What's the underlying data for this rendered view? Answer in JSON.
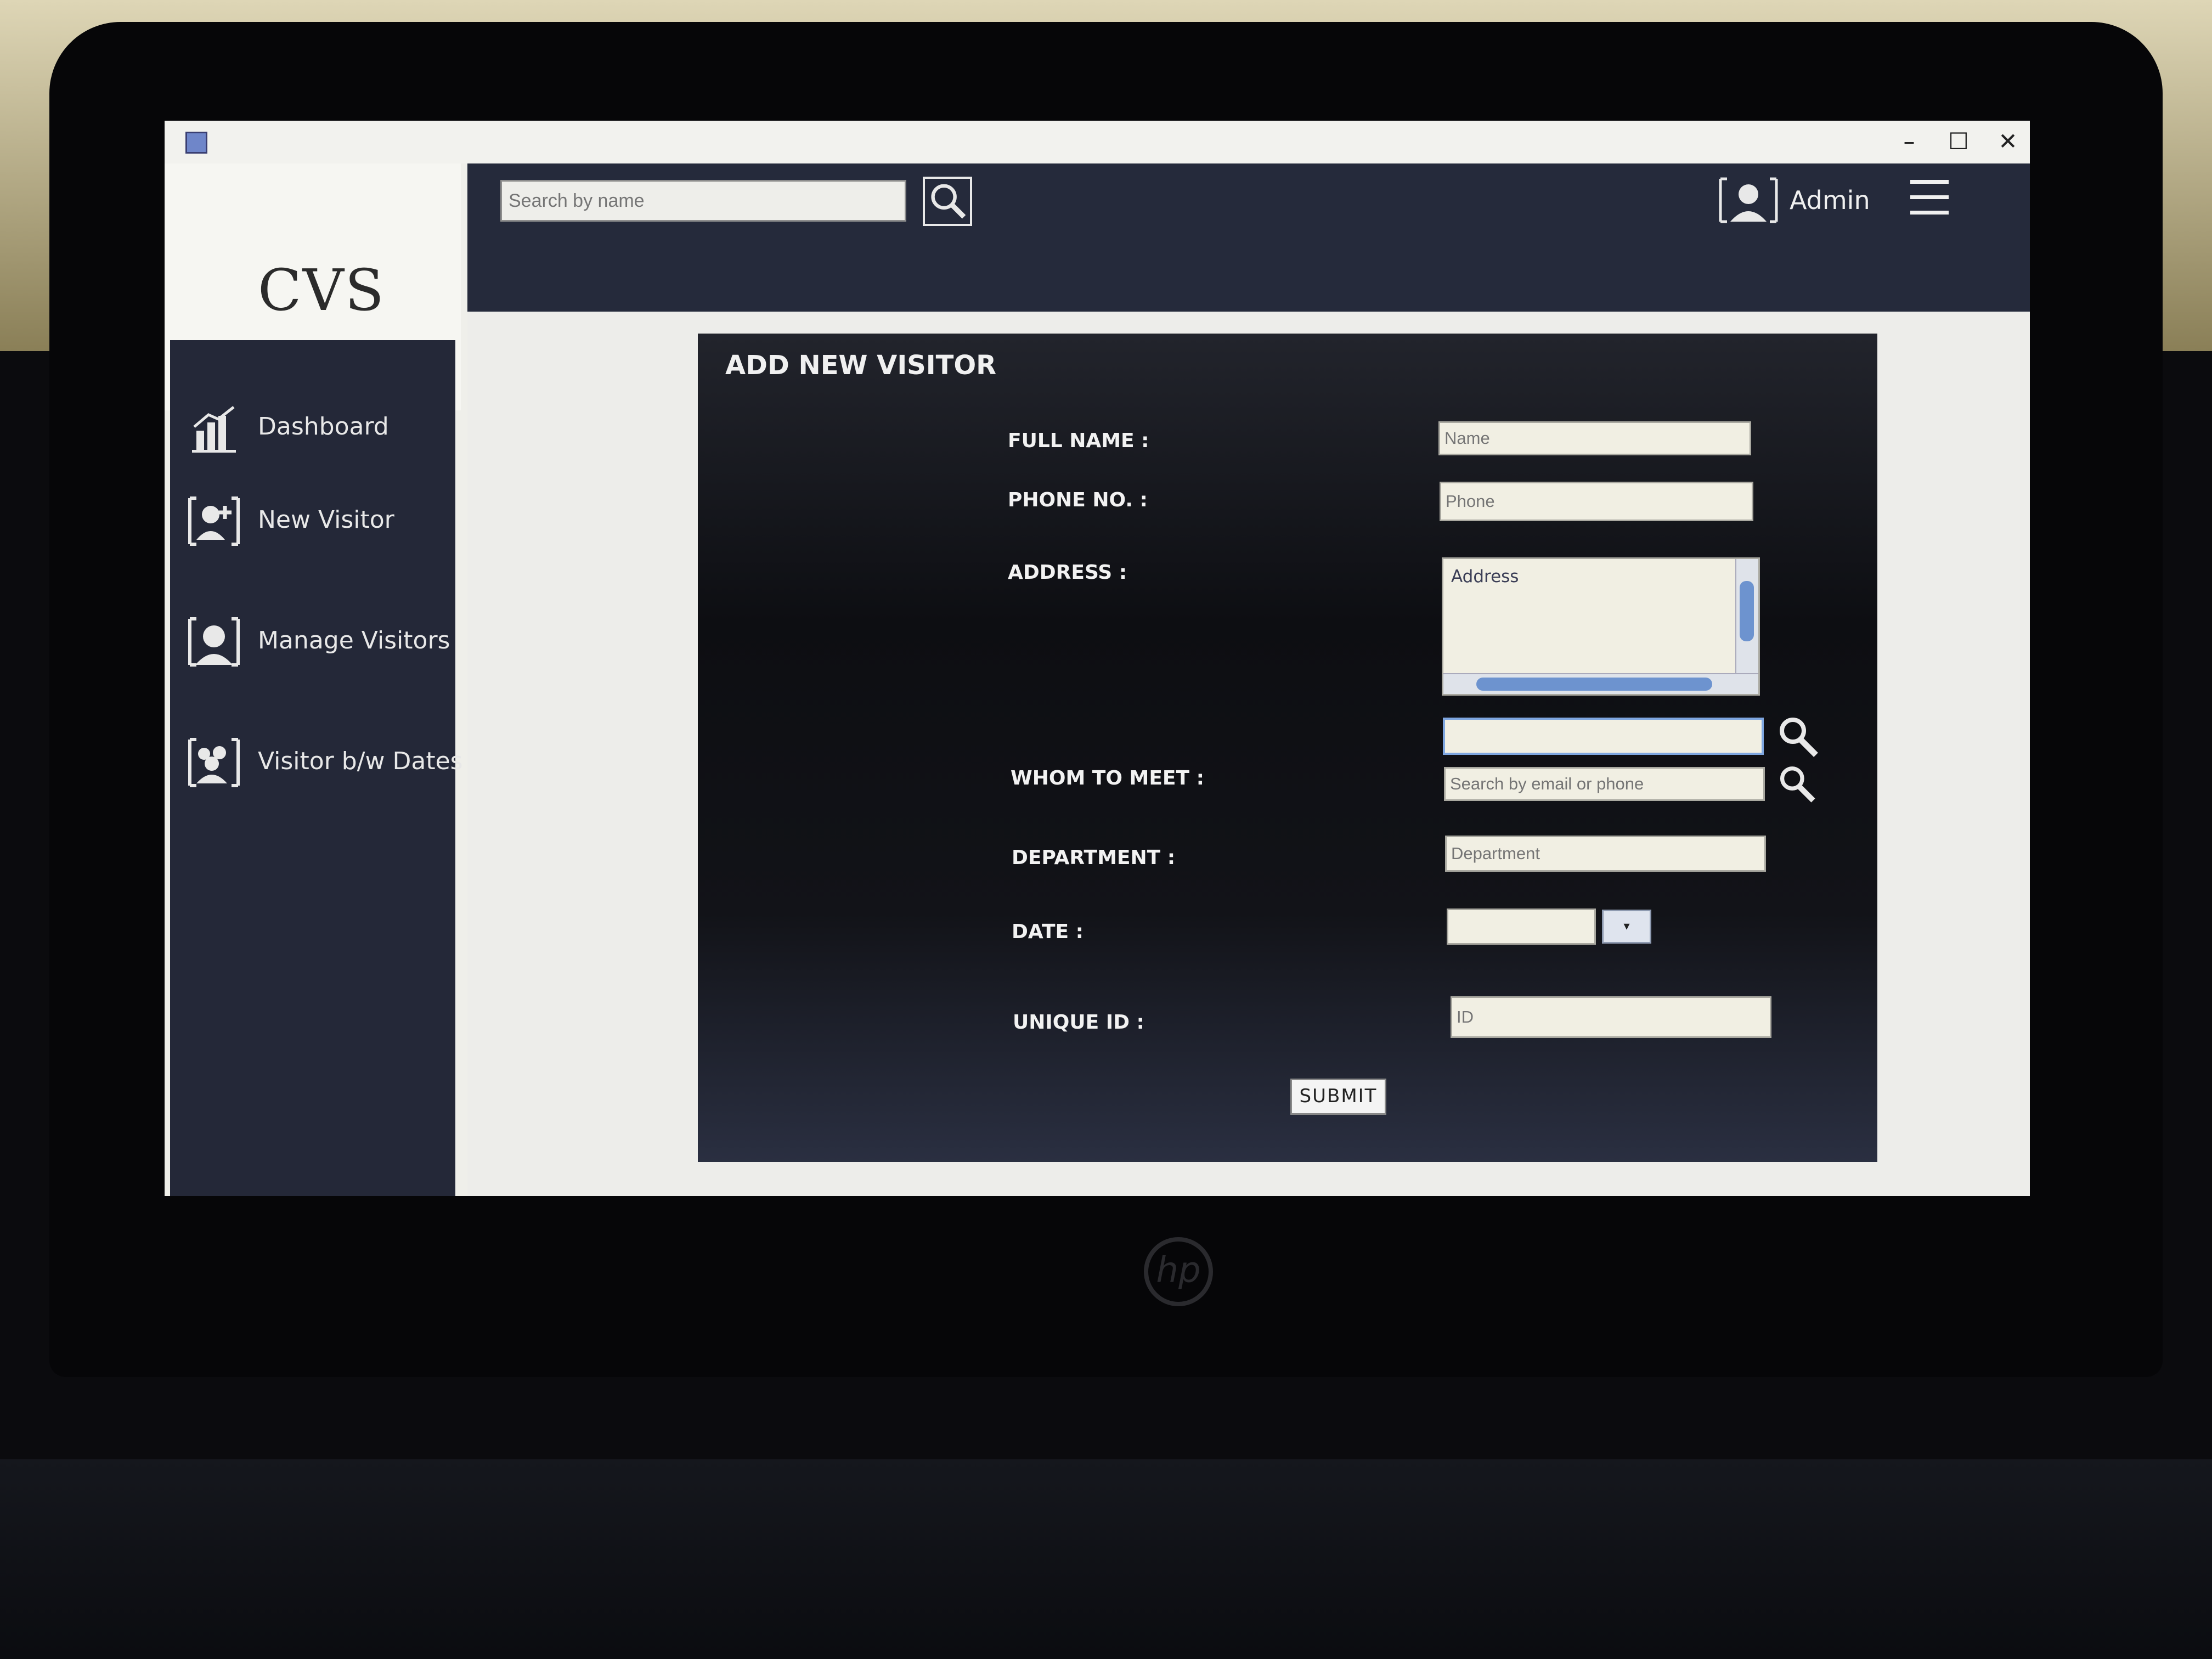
{
  "window": {
    "controls": {
      "minimize": "–",
      "maximize": "☐",
      "close": "✕"
    }
  },
  "brand": "CVS",
  "header": {
    "search_placeholder": "Search by name",
    "admin_label": "Admin",
    "icons": [
      "search-icon",
      "user-avatar-icon",
      "hamburger-menu-icon"
    ]
  },
  "sidebar": {
    "items": [
      {
        "label": "Dashboard",
        "icon": "bar-chart-icon"
      },
      {
        "label": "New Visitor",
        "icon": "add-user-icon"
      },
      {
        "label": "Manage Visitors",
        "icon": "user-icon"
      },
      {
        "label": "Visitor b/w Dates",
        "icon": "users-group-icon"
      }
    ]
  },
  "form": {
    "title": "ADD NEW VISITOR",
    "labels": {
      "full_name": "FULL NAME :",
      "phone": "PHONE NO. :",
      "address": "ADDRESS :",
      "whom_to_meet": "WHOM TO MEET :",
      "department": "DEPARTMENT :",
      "date": "DATE :",
      "unique_id": "UNIQUE ID :"
    },
    "placeholders": {
      "full_name": "Name",
      "phone": "Phone",
      "address": "Address",
      "whom_to_meet_search": "Search by email or phone",
      "department": "Department",
      "unique_id": "ID"
    },
    "values": {
      "whom_to_meet": "",
      "date": ""
    },
    "date_picker_glyph": "▾",
    "submit_label": "SUBMIT"
  },
  "colors": {
    "sidebar_bg": "#242838",
    "header_bg": "#252a3b",
    "form_bg": "#0d0e12",
    "field_bg": "#f1efe3",
    "accent": "#6d93cf"
  }
}
